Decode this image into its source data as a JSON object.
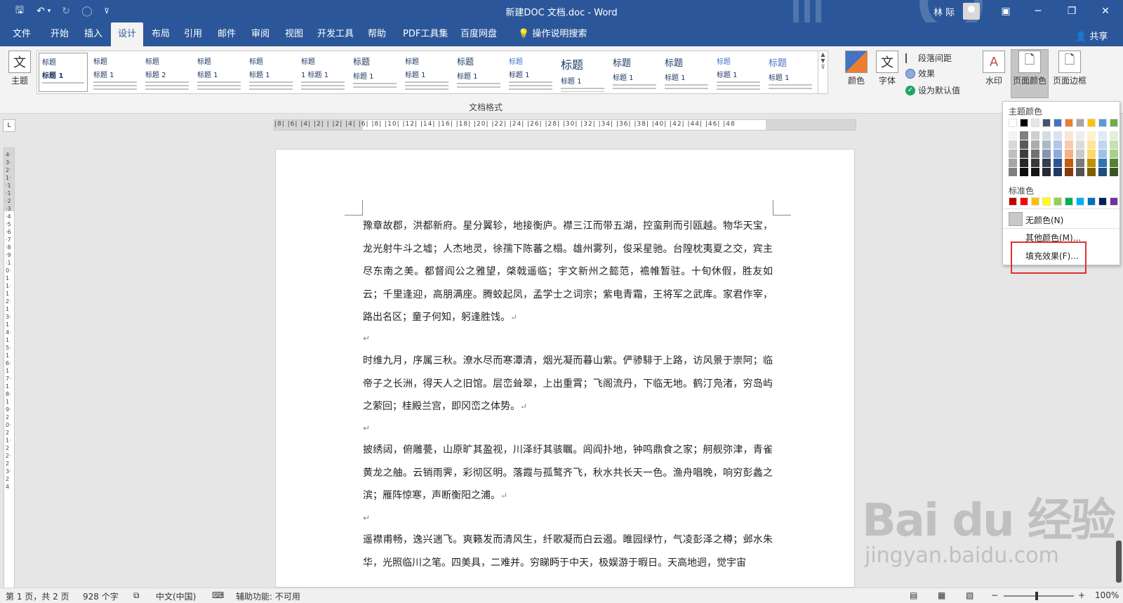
{
  "titlebar": {
    "title": "新建DOC 文档.doc  -  Word",
    "user": "林 际",
    "quick_access": {
      "save": "🖫",
      "undo": "↶",
      "undo_drop": "▾",
      "redo": "↻",
      "repeat": "◯",
      "customize": "⊽"
    },
    "window_buttons": {
      "ribbon_display": "▣",
      "minimize": "─",
      "restore": "❐",
      "close": "✕"
    }
  },
  "tabs": [
    "文件",
    "开始",
    "插入",
    "设计",
    "布局",
    "引用",
    "邮件",
    "审阅",
    "视图",
    "开发工具",
    "帮助",
    "PDF工具集",
    "百度网盘"
  ],
  "active_tab": "设计",
  "tell_me": "操作说明搜索",
  "share": "共享",
  "ribbon": {
    "theme_label": "主题",
    "gallery_label": "文档格式",
    "styles": [
      {
        "h": "标题",
        "sub": "标题 1"
      },
      {
        "h": "标题",
        "sub": "标题 1"
      },
      {
        "h": "标题",
        "sub": "标题 2"
      },
      {
        "h": "标题",
        "sub": "标题 1"
      },
      {
        "h": "标题",
        "sub": "标题 1"
      },
      {
        "h": "标题",
        "sub": "1 标题 1"
      },
      {
        "h": "标题",
        "sub": "标题 1"
      },
      {
        "h": "标题",
        "sub": "标题 1"
      },
      {
        "h": "标题",
        "sub": "标题 1"
      },
      {
        "h": "标题",
        "sub": "标题 1"
      },
      {
        "h": "标题",
        "sub": "标题 1"
      },
      {
        "h": "标题",
        "sub": "标题 1"
      },
      {
        "h": "标题",
        "sub": "标题 1"
      },
      {
        "h": "标题",
        "sub": "标题 1"
      },
      {
        "h": "标题",
        "sub": "标题 1"
      }
    ],
    "colors_label": "颜色",
    "fonts_label": "字体",
    "fonts_glyph": "文",
    "paragraph_spacing": "段落间距",
    "effects": "效果",
    "set_default": "设为默认值",
    "watermark": "水印",
    "page_color": "页面颜色",
    "page_borders": "页面边框"
  },
  "dropdown": {
    "theme_colors_heading": "主题颜色",
    "standard_colors_heading": "标准色",
    "no_color": "无颜色(N)",
    "more_colors": "其他颜色(M)...",
    "fill_effects": "填充效果(F)...",
    "theme_row": [
      "#ffffff",
      "#000000",
      "#e7e6e6",
      "#44546a",
      "#4472c4",
      "#ed7d31",
      "#a5a5a5",
      "#ffc000",
      "#5b9bd5",
      "#70ad47"
    ],
    "theme_shades": [
      [
        "#f2f2f2",
        "#7f7f7f",
        "#d0cece",
        "#d6dce4",
        "#d9e2f3",
        "#fbe5d5",
        "#ededed",
        "#fff2cc",
        "#deebf6",
        "#e2efd9"
      ],
      [
        "#d8d8d8",
        "#595959",
        "#aeabab",
        "#adb9ca",
        "#b4c6e7",
        "#f7caac",
        "#dbdbdb",
        "#fee599",
        "#bdd7ee",
        "#c5e0b3"
      ],
      [
        "#bfbfbf",
        "#3f3f3f",
        "#757070",
        "#8496b0",
        "#8eaadb",
        "#f4b183",
        "#c9c9c9",
        "#ffd965",
        "#9cc3e5",
        "#a8d08d"
      ],
      [
        "#a5a5a5",
        "#262626",
        "#3a3838",
        "#323f4f",
        "#2f5496",
        "#c55a11",
        "#7b7b7b",
        "#bf9000",
        "#2e75b5",
        "#538135"
      ],
      [
        "#7f7f7f",
        "#0c0c0c",
        "#171616",
        "#222a35",
        "#1f3864",
        "#833c0b",
        "#525252",
        "#7f6000",
        "#1e4e79",
        "#375623"
      ]
    ],
    "standard": [
      "#c00000",
      "#ff0000",
      "#ffc000",
      "#ffff00",
      "#92d050",
      "#00b050",
      "#00b0f0",
      "#0070c0",
      "#002060",
      "#7030a0"
    ]
  },
  "ruler": {
    "horizontal": "|8|  |6|  |4|  |2|  |  |2|  |4|  |6|  |8|  |10|  |12|  |14|  |16|  |18|  |20|  |22|  |24|  |26|  |28|  |30|  |32|  |34|  |36|  |38|  |40|  |42|  |44|  |46|  |48",
    "vertical": "4·3·2·1··1·1·2·3·4·5·6·7·8·9·10·11·12·13·14·15·16·17·18·19·20·21·22·23·24"
  },
  "document": {
    "paragraphs": [
      "豫章故郡，洪都新府。星分翼轸，地接衡庐。襟三江而带五湖，控蛮荆而引瓯越。物华天宝，龙光射牛斗之墟；人杰地灵，徐孺下陈蕃之榻。雄州雾列，俊采星驰。台隍枕夷夏之交，宾主尽东南之美。都督阎公之雅望，棨戟遥临；宇文新州之懿范，襜帷暂驻。十旬休假，胜友如云；千里逢迎，高朋满座。腾蛟起凤，孟学士之词宗；紫电青霜，王将军之武库。家君作宰，路出名区；童子何知，躬逢胜饯。",
      "时维九月，序属三秋。潦水尽而寒潭清，烟光凝而暮山紫。俨骖騑于上路，访风景于崇阿；临帝子之长洲，得天人之旧馆。层峦耸翠，上出重霄；飞阁流丹，下临无地。鹤汀凫渚，穷岛屿之萦回；桂殿兰宫，即冈峦之体势。",
      "披绣闼，俯雕甍，山原旷其盈视，川泽纡其骇瞩。闾阎扑地，钟鸣鼎食之家；舸舰弥津，青雀黄龙之舳。云销雨霁，彩彻区明。落霞与孤鹜齐飞，秋水共长天一色。渔舟唱晚，响穷彭蠡之滨；雁阵惊寒，声断衡阳之浦。",
      "遥襟甫畅，逸兴遄飞。爽籁发而清风生，纤歌凝而白云遏。睢园绿竹，气凌彭泽之樽；邺水朱华，光照临川之笔。四美具，二难并。穷睇眄于中天，极娱游于暇日。天高地迥，觉宇宙"
    ],
    "para_mark": "↵"
  },
  "status": {
    "page": "第 1 页，共 2 页",
    "words": "928 个字",
    "language": "中文(中国)",
    "accessibility": "辅助功能: 不可用",
    "zoom": "100%",
    "zoom_minus": "−",
    "zoom_plus": "+"
  },
  "watermark": {
    "big": "Bai du 经验",
    "small": "jingyan.baidu.com"
  }
}
